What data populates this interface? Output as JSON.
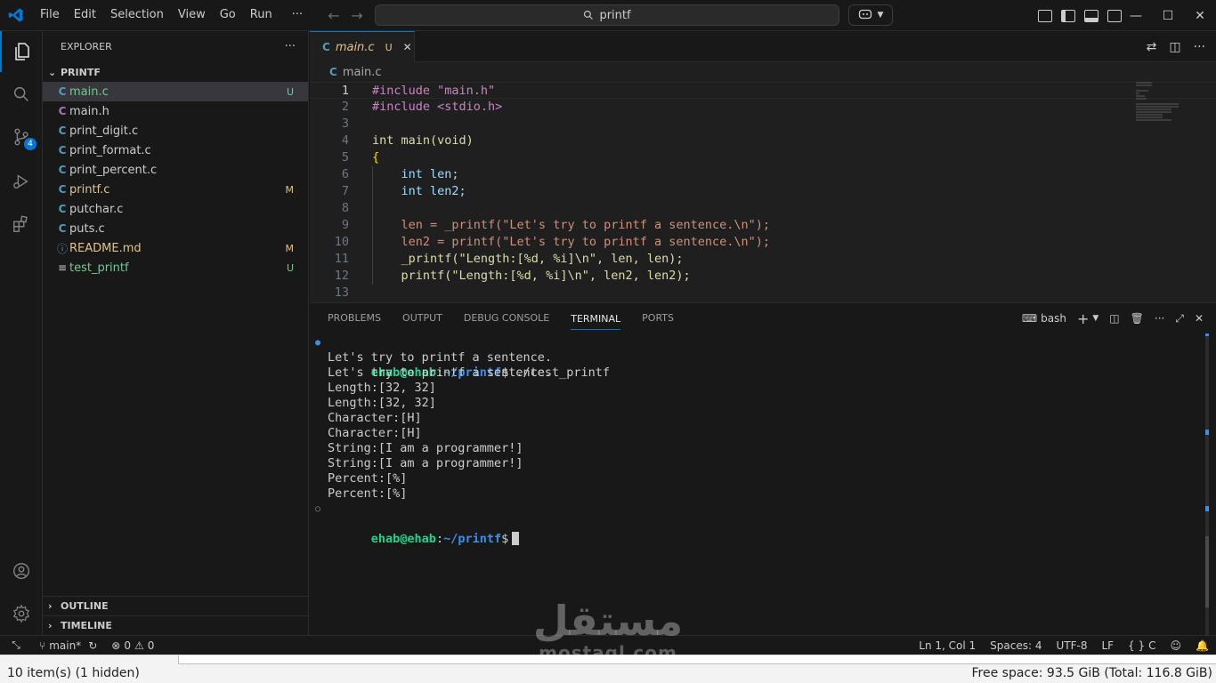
{
  "titlebar": {
    "menu": [
      "File",
      "Edit",
      "Selection",
      "View",
      "Go",
      "Run",
      "···"
    ],
    "search_text": "printf"
  },
  "activitybar": {
    "source_control_badge": "4"
  },
  "sidebar": {
    "title": "EXPLORER",
    "more": "···",
    "folder": "PRINTF",
    "files": [
      {
        "name": "main.c",
        "icon": "C",
        "status": "U"
      },
      {
        "name": "main.h",
        "icon": "C",
        "status": ""
      },
      {
        "name": "print_digit.c",
        "icon": "C",
        "status": ""
      },
      {
        "name": "print_format.c",
        "icon": "C",
        "status": ""
      },
      {
        "name": "print_percent.c",
        "icon": "C",
        "status": ""
      },
      {
        "name": "printf.c",
        "icon": "C",
        "status": "M"
      },
      {
        "name": "putchar.c",
        "icon": "C",
        "status": ""
      },
      {
        "name": "puts.c",
        "icon": "C",
        "status": ""
      },
      {
        "name": "README.md",
        "icon": "ⓘ",
        "status": "M"
      },
      {
        "name": "test_printf",
        "icon": "≡",
        "status": "U"
      }
    ],
    "outline": "OUTLINE",
    "timeline": "TIMELINE"
  },
  "editor": {
    "tab": {
      "icon": "C",
      "name": "main.c",
      "status": "U",
      "close": "✕"
    },
    "breadcrumb": "main.c",
    "lines": [
      {
        "n": "1",
        "code": "#include \"main.h\""
      },
      {
        "n": "2",
        "code": "#include <stdio.h>"
      },
      {
        "n": "3",
        "code": ""
      },
      {
        "n": "4",
        "code": "int main(void)"
      },
      {
        "n": "5",
        "code": "{"
      },
      {
        "n": "6",
        "code": "    int len;"
      },
      {
        "n": "7",
        "code": "    int len2;"
      },
      {
        "n": "8",
        "code": ""
      },
      {
        "n": "9",
        "code": "    len = _printf(\"Let's try to printf a sentence.\\n\");"
      },
      {
        "n": "10",
        "code": "    len2 = printf(\"Let's try to printf a sentence.\\n\");"
      },
      {
        "n": "11",
        "code": "    _printf(\"Length:[%d, %i]\\n\", len, len);"
      },
      {
        "n": "12",
        "code": "    printf(\"Length:[%d, %i]\\n\", len2, len2);"
      },
      {
        "n": "13",
        "code": ""
      }
    ]
  },
  "panel": {
    "tabs": [
      "PROBLEMS",
      "OUTPUT",
      "DEBUG CONSOLE",
      "TERMINAL",
      "PORTS"
    ],
    "shell": "bash",
    "prompt_user": "ehab@ehab",
    "prompt_path": "~/printf",
    "command": "./test_printf",
    "output": [
      "Let's try to printf a sentence.",
      "Let's try to printf a sentence.",
      "Length:[32, 32]",
      "Length:[32, 32]",
      "Character:[H]",
      "Character:[H]",
      "String:[I am a programmer!]",
      "String:[I am a programmer!]",
      "Percent:[%]",
      "Percent:[%]"
    ]
  },
  "statusbar": {
    "branch": "main*",
    "errors": "0",
    "warnings": "0",
    "position": "Ln 1, Col 1",
    "spaces": "Spaces: 4",
    "encoding": "UTF-8",
    "eol": "LF",
    "language": "C"
  },
  "filemanager": {
    "items": "10 item(s) (1 hidden)",
    "free_space": "Free space: 93.5 GiB (Total: 116.8 GiB)"
  },
  "watermark": {
    "arabic": "مستقل",
    "latin": "mostaql.com"
  },
  "colors": {
    "accent": "#0078d4",
    "untracked": "#73c991",
    "modified": "#e2c08d",
    "c_icon": "#519aba",
    "prompt_green": "#23d18b",
    "prompt_blue": "#3b8eea"
  }
}
